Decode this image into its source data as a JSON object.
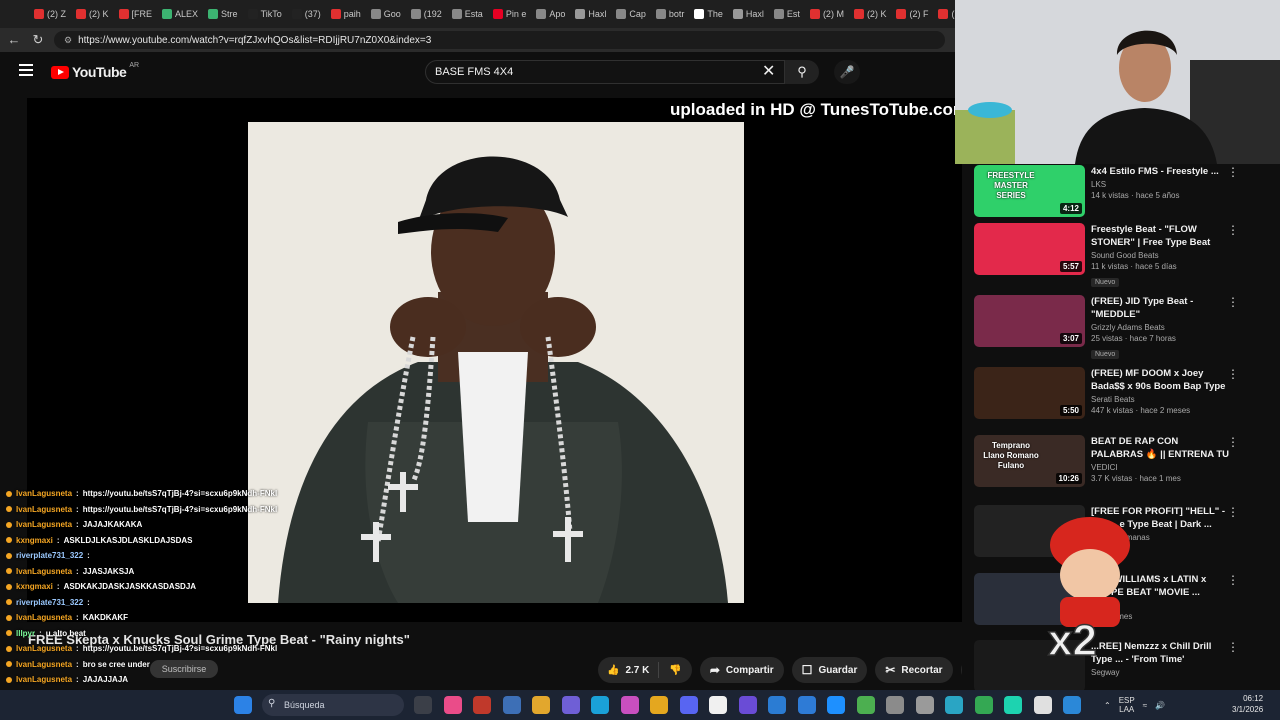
{
  "browser": {
    "tabs": [
      {
        "label": "(2) Z",
        "color": "#e03030"
      },
      {
        "label": "(2) K",
        "color": "#e03030"
      },
      {
        "label": "[FRE",
        "color": "#e03030"
      },
      {
        "label": "ALEX",
        "color": "#3cb371"
      },
      {
        "label": "Stre",
        "color": "#3cb371"
      },
      {
        "label": "TikTo",
        "color": "#222222"
      },
      {
        "label": "(37)",
        "color": "#222222"
      },
      {
        "label": "paih",
        "color": "#e03030"
      },
      {
        "label": "Goo",
        "color": "#888888"
      },
      {
        "label": "(192",
        "color": "#888888"
      },
      {
        "label": "Esta",
        "color": "#888888"
      },
      {
        "label": "Pin e",
        "color": "#e60023"
      },
      {
        "label": "Apo",
        "color": "#888888"
      },
      {
        "label": "Haxl",
        "color": "#999999"
      },
      {
        "label": "Cap",
        "color": "#888888"
      },
      {
        "label": "botr",
        "color": "#888888"
      },
      {
        "label": "The",
        "color": "#ffffff"
      },
      {
        "label": "Haxl",
        "color": "#999999"
      },
      {
        "label": "Est",
        "color": "#888888"
      },
      {
        "label": "(2) M",
        "color": "#e03030"
      },
      {
        "label": "(2) K",
        "color": "#e03030"
      },
      {
        "label": "(2) F",
        "color": "#e03030"
      },
      {
        "label": "(2) M",
        "color": "#e03030"
      },
      {
        "label": "(2) M",
        "color": "#e03030"
      }
    ],
    "url": "https://www.youtube.com/watch?v=rqfZJxvhQOs&list=RDIjjRU7nZ0X0&index=3"
  },
  "youtube": {
    "logo": "YouTube",
    "country": "AR",
    "search_value": "BASE FMS 4X4",
    "watermark": "uploaded in HD @ TunesToTube.com",
    "video_title": "FREE Skepta x Knucks Soul Grime Type Beat - \"Rainy nights\"",
    "likes": "2.7 K",
    "share_label": "Compartir",
    "save_label": "Guardar",
    "clip_label": "Recortar",
    "subscribe_label": "Suscribirse"
  },
  "chat": [
    {
      "user": "IvanLagusneta",
      "msg": "https://youtu.be/tsS7qTjBj-4?si=scxu6p9kNdh-FNkl",
      "color": "orange"
    },
    {
      "user": "IvanLagusneta",
      "msg": "https://youtu.be/tsS7qTjBj-4?si=scxu6p9kNdh-FNkl",
      "color": "orange"
    },
    {
      "user": "IvanLagusneta",
      "msg": "JAJAJKAKAKA",
      "color": "orange"
    },
    {
      "user": "kxngmaxi",
      "msg": "ASKLDJLKASJDLASKLDAJSDAS",
      "color": "orange"
    },
    {
      "user": "riverplate731_322",
      "msg": "",
      "color": "blue"
    },
    {
      "user": "IvanLagusneta",
      "msg": "JJASJAKSJA",
      "color": "orange"
    },
    {
      "user": "kxngmaxi",
      "msg": "ASDKAKJDASKJASKKASDASDJA",
      "color": "orange"
    },
    {
      "user": "riverplate731_322",
      "msg": "",
      "color": "blue"
    },
    {
      "user": "IvanLagusneta",
      "msg": "KAKDKAKF",
      "color": "orange"
    },
    {
      "user": "lllpyr",
      "msg": "u alto beat",
      "color": "green"
    },
    {
      "user": "IvanLagusneta",
      "msg": "https://youtu.be/tsS7qTjBj-4?si=scxu6p9kNdh-FNkl",
      "color": "orange"
    },
    {
      "user": "IvanLagusneta",
      "msg": "bro se cree under",
      "color": "orange"
    },
    {
      "user": "IvanLagusneta",
      "msg": "JAJAJJAJA",
      "color": "orange"
    },
    {
      "user": "kxngmaxi",
      "msg": "DJASJD",
      "color": "orange"
    },
    {
      "user": "kxngmaxi",
      "msg": "arrancaba una cancion",
      "color": "orange"
    }
  ],
  "recommendations": [
    {
      "title": "4x4 Estilo FMS - Freestyle ...",
      "channel": "LKS",
      "meta": "14 k vistas · hace 5 años",
      "duration": "4:12",
      "new": "",
      "thumb": "#2fd06a",
      "thumb_text": "FREESTYLE MASTER SERIES"
    },
    {
      "title": "Freestyle Beat - \"FLOW STONER\" | Free Type Beat 202...",
      "channel": "Sound Good Beats",
      "meta": "11 k vistas · hace 5 días",
      "duration": "5:57",
      "new": "Nuevo",
      "thumb": "#e3294b",
      "thumb_text": ""
    },
    {
      "title": "(FREE) JID Type Beat - \"MEDDLE\"",
      "channel": "Grizzly Adams Beats",
      "meta": "25 vistas · hace 7 horas",
      "duration": "3:07",
      "new": "Nuevo",
      "thumb": "#7a2a4a",
      "thumb_text": ""
    },
    {
      "title": "(FREE) MF DOOM x Joey Bada$$ x 90s Boom Bap Type ...",
      "channel": "Serati Beats",
      "meta": "447 k vistas · hace 2 meses",
      "duration": "5:50",
      "new": "",
      "thumb": "#3b2418",
      "thumb_text": ""
    },
    {
      "title": "BEAT DE RAP CON PALABRAS 🔥 || ENTRENA TU FREESTYL...",
      "channel": "VEDICI",
      "meta": "3.7 K vistas · hace 1 mes",
      "duration": "10:26",
      "new": "",
      "thumb": "#3a2a25",
      "thumb_text": "Temprano Llano Romano Fulano"
    },
    {
      "title": "[FREE FOR PROFIT] \"HELL\" - Rap ...e Type Beat | Dark ...",
      "channel": "",
      "meta": "hace 2 semanas",
      "duration": "",
      "new": "",
      "thumb": "#222222",
      "thumb_text": ""
    },
    {
      "title": "...EL WILLIAMS x LATIN x ...TYPE BEAT \"MOVIE ...",
      "channel": "...Beats",
      "meta": "hace 1 mes",
      "duration": "",
      "new": "",
      "thumb": "#2a2f3a",
      "thumb_text": ""
    },
    {
      "title": "...REE] Nemzzz x Chill Drill Type ... - 'From Time'",
      "channel": "Segway",
      "meta": "",
      "duration": "",
      "new": "",
      "thumb": "#1a1a1a",
      "thumb_text": ""
    }
  ],
  "overlay": {
    "multiplier": "x2"
  },
  "taskbar": {
    "search_placeholder": "Búsqueda",
    "lang_top": "ESP",
    "lang_bottom": "LAA",
    "time": "06:12",
    "date": "3/1/2026"
  }
}
